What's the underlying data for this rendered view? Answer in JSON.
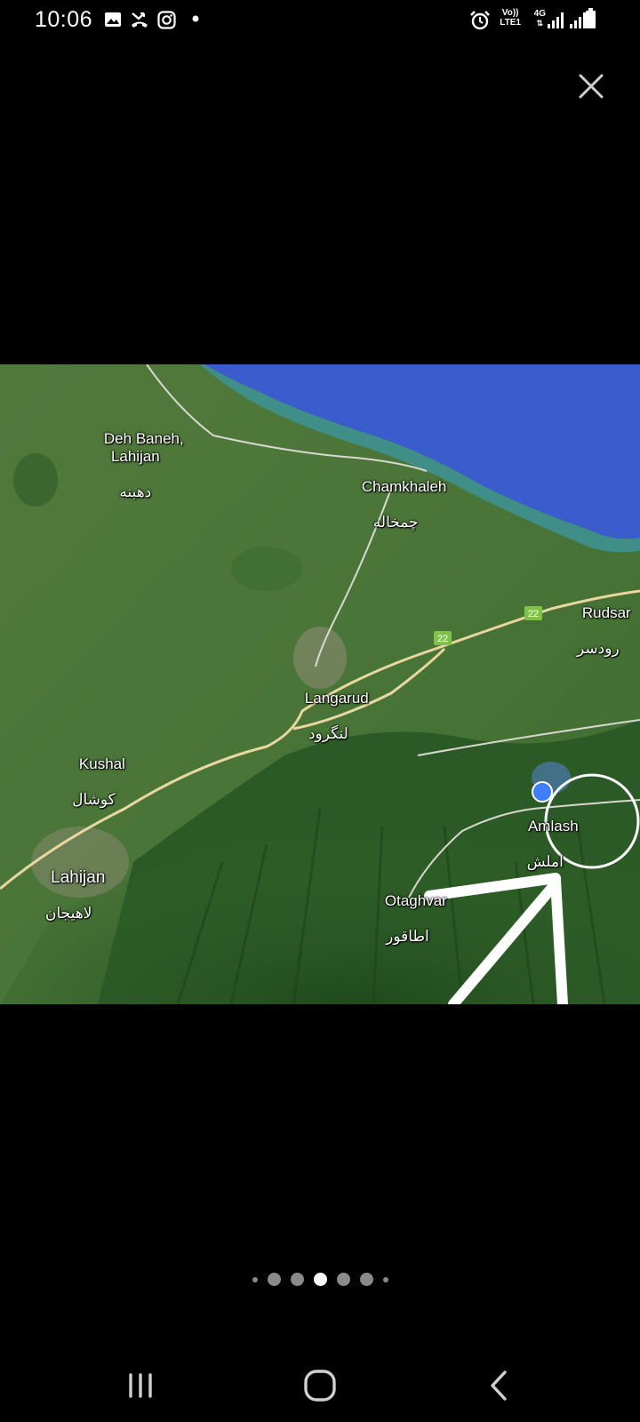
{
  "status_bar": {
    "time": "10:06",
    "left_icons": [
      "gallery-icon",
      "missed-call-icon",
      "instagram-icon",
      "notification-dot-icon"
    ],
    "right_icons": [
      "alarm-icon",
      "volte-icon",
      "4g-icon",
      "signal-icon",
      "signal-icon",
      "battery-icon"
    ],
    "volte_text_1": "Vo))",
    "volte_text_2": "LTE1",
    "network_label": "4G"
  },
  "viewer": {
    "close_icon": "close-icon"
  },
  "map": {
    "labels": [
      {
        "name": "Deh Baneh,\nLahijan",
        "local": "دهبنه"
      },
      {
        "name": "Chamkhaleh",
        "local": "چمخاله"
      },
      {
        "name": "Rudsar",
        "local": "رودسر"
      },
      {
        "name": "Langarud",
        "local": "لنگرود"
      },
      {
        "name": "Kushal",
        "local": "کوشال"
      },
      {
        "name": "Amlash",
        "local": "املش"
      },
      {
        "name": "Lahijan",
        "local": "لاهیجان"
      },
      {
        "name": "Otaghvar",
        "local": "اطاقور"
      }
    ],
    "road_badges": [
      "22",
      "22"
    ],
    "colors": {
      "sea": "#3a5ccc",
      "land": "#4d7a3a",
      "forest": "#2f5e28",
      "road": "#e8d8a0"
    }
  },
  "pagination": {
    "count": 8,
    "active_index": 3
  },
  "nav_bar": {
    "buttons": [
      "recent-apps-icon",
      "home-icon",
      "back-icon"
    ]
  }
}
